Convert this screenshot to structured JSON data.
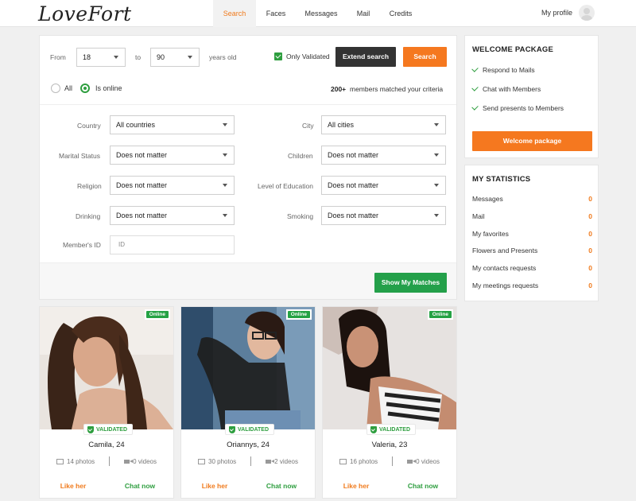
{
  "header": {
    "logo": "LoveFort",
    "nav": [
      {
        "label": "Search",
        "active": true
      },
      {
        "label": "Faces",
        "active": false
      },
      {
        "label": "Messages",
        "active": false
      },
      {
        "label": "Mail",
        "active": false
      },
      {
        "label": "Credits",
        "active": false
      }
    ],
    "profile_label": "My profile"
  },
  "search": {
    "from_label": "From",
    "age_from": "18",
    "to_label": "to",
    "age_to": "90",
    "years_label": "years old",
    "only_validated_label": "Only Validated",
    "only_validated_checked": true,
    "extend_label": "Extend search",
    "search_label": "Search",
    "radio_all_label": "All",
    "radio_online_label": "Is online",
    "matched_count": "200+",
    "matched_text": "members matched your criteria",
    "filters": {
      "country": {
        "label": "Country",
        "value": "All countries"
      },
      "city": {
        "label": "City",
        "value": "All cities"
      },
      "marital": {
        "label": "Marital Status",
        "value": "Does not matter"
      },
      "children": {
        "label": "Children",
        "value": "Does not matter"
      },
      "religion": {
        "label": "Religion",
        "value": "Does not matter"
      },
      "education": {
        "label": "Level of Education",
        "value": "Does not matter"
      },
      "drinking": {
        "label": "Drinking",
        "value": "Does not matter"
      },
      "smoking": {
        "label": "Smoking",
        "value": "Does not matter"
      }
    },
    "member_id_label": "Member's ID",
    "member_id_placeholder": "ID",
    "show_matches_label": "Show My Matches"
  },
  "welcome": {
    "title": "WELCOME PACKAGE",
    "items": [
      "Respond to Mails",
      "Chat with Members",
      "Send presents to Members"
    ],
    "button_label": "Welcome package"
  },
  "stats": {
    "title": "MY STATISTICS",
    "rows": [
      {
        "label": "Messages",
        "value": "0"
      },
      {
        "label": "Mail",
        "value": "0"
      },
      {
        "label": "My favorites",
        "value": "0"
      },
      {
        "label": "Flowers and Presents",
        "value": "0"
      },
      {
        "label": "My contacts requests",
        "value": "0"
      },
      {
        "label": "My meetings requests",
        "value": "0"
      }
    ]
  },
  "members": [
    {
      "name": "Camila, 24",
      "photos": "14 photos",
      "videos": "0 videos",
      "online": "Online",
      "validated": "VALIDATED",
      "like": "Like her",
      "chat": "Chat now"
    },
    {
      "name": "Oriannys, 24",
      "photos": "30 photos",
      "videos": "2 videos",
      "online": "Online",
      "validated": "VALIDATED",
      "like": "Like her",
      "chat": "Chat now"
    },
    {
      "name": "Valeria, 23",
      "photos": "16 photos",
      "videos": "0 videos",
      "online": "Online",
      "validated": "VALIDATED",
      "like": "Like her",
      "chat": "Chat now"
    }
  ],
  "colors": {
    "accent_orange": "#f5781f",
    "accent_green": "#24a04a",
    "dark_button": "#333333"
  }
}
